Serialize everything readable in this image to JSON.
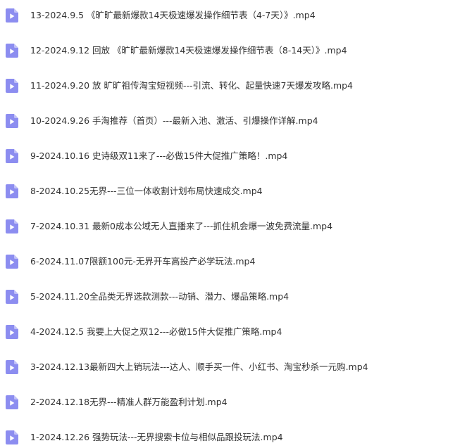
{
  "theme": {
    "icon_color": "#8c8df0",
    "text_color": "#333333"
  },
  "files": [
    {
      "name": "13-2024.9.5 《旷旷最新爆款14天极速爆发操作细节表（4-7天）》.mp4",
      "icon": "video-file-icon"
    },
    {
      "name": "12-2024.9.12 回放 《旷旷最新爆款14天极速爆发操作细节表（8-14天）》.mp4",
      "icon": "video-file-icon"
    },
    {
      "name": "11-2024.9.20 放 旷旷祖传淘宝短视频---引流、转化、起量快速7天爆发攻略.mp4",
      "icon": "video-file-icon"
    },
    {
      "name": "10-2024.9.26 手淘推荐（首页）---最新入池、激活、引爆操作详解.mp4",
      "icon": "video-file-icon"
    },
    {
      "name": "9-2024.10.16 史诗级双11来了---必做15件大促推广策略！.mp4",
      "icon": "video-file-icon"
    },
    {
      "name": "8-2024.10.25无界---三位一体收割计划布局快速成交.mp4",
      "icon": "video-file-icon"
    },
    {
      "name": "7-2024.10.31 最新0成本公域无人直播来了---抓住机会爆一波免费流量.mp4",
      "icon": "video-file-icon"
    },
    {
      "name": "6-2024.11.07限额100元-无界开车高投产必学玩法.mp4",
      "icon": "video-file-icon"
    },
    {
      "name": "5-2024.11.20全品类无界选款测款---动销、潜力、爆品策略.mp4",
      "icon": "video-file-icon"
    },
    {
      "name": "4-2024.12.5 我要上大促之双12---必做15件大促推广策略.mp4",
      "icon": "video-file-icon"
    },
    {
      "name": "3-2024.12.13最新四大上销玩法---达人、顺手买一件、小红书、淘宝秒杀一元购.mp4",
      "icon": "video-file-icon"
    },
    {
      "name": "2-2024.12.18无界---精准人群万能盈利计划.mp4",
      "icon": "video-file-icon"
    },
    {
      "name": "1-2024.12.26 强势玩法---无界搜索卡位与相似品跟投玩法.mp4",
      "icon": "video-file-icon"
    }
  ]
}
